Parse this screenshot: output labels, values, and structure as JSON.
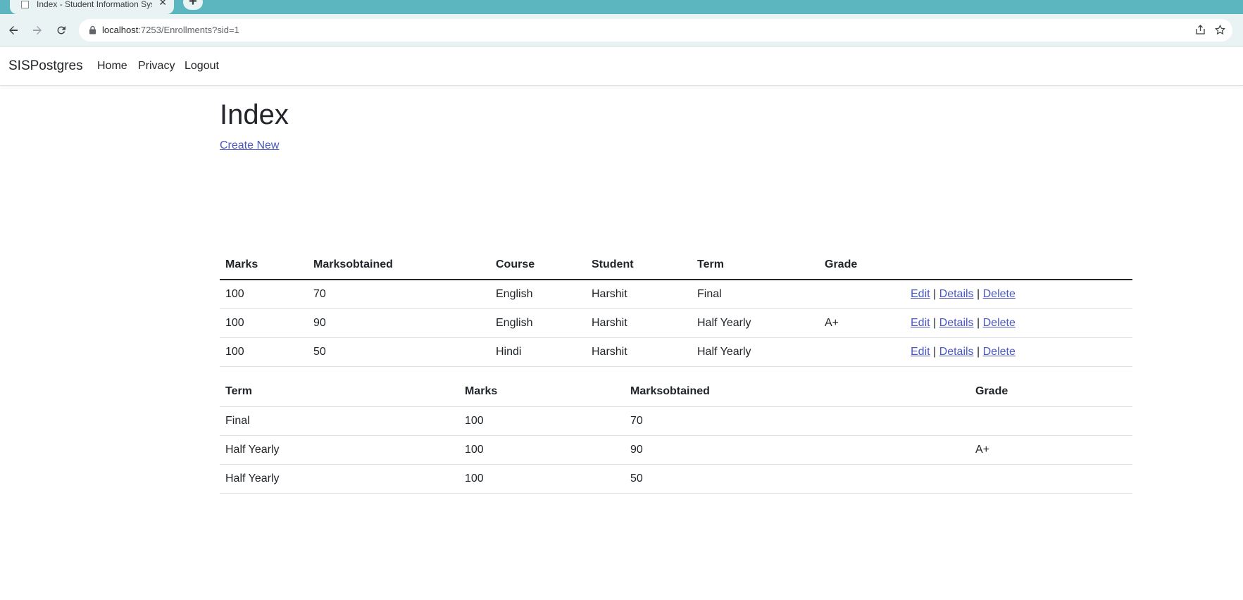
{
  "browser": {
    "tab_title": "Index - Student Information System",
    "tab_close": "✕",
    "new_tab": "+",
    "url_host": "localhost",
    "url_path": ":7253/Enrollments?sid=1"
  },
  "navbar": {
    "brand": "SISPostgres",
    "links": [
      "Home",
      "Privacy",
      "Logout"
    ]
  },
  "page": {
    "title": "Index",
    "create_link": "Create New"
  },
  "enrollments_table": {
    "headers": [
      "Marks",
      "Marksobtained",
      "Course",
      "Student",
      "Term",
      "Grade"
    ],
    "rows": [
      {
        "marks": "100",
        "marksobtained": "70",
        "course": "English",
        "student": "Harshit",
        "term": "Final",
        "grade": ""
      },
      {
        "marks": "100",
        "marksobtained": "90",
        "course": "English",
        "student": "Harshit",
        "term": "Half Yearly",
        "grade": "A+"
      },
      {
        "marks": "100",
        "marksobtained": "50",
        "course": "Hindi",
        "student": "Harshit",
        "term": "Half Yearly",
        "grade": ""
      }
    ],
    "actions": {
      "edit": "Edit",
      "details": "Details",
      "delete": "Delete",
      "separator": "|"
    }
  },
  "summary_table": {
    "headers": [
      "Term",
      "Marks",
      "Marksobtained",
      "Grade"
    ],
    "rows": [
      {
        "term": "Final",
        "marks": "100",
        "marksobtained": "70",
        "grade": ""
      },
      {
        "term": "Half Yearly",
        "marks": "100",
        "marksobtained": "90",
        "grade": "A+"
      },
      {
        "term": "Half Yearly",
        "marks": "100",
        "marksobtained": "50",
        "grade": ""
      }
    ]
  },
  "colors": {
    "chrome_accent": "#5cb6bf",
    "toolbar_bg": "#eaf3f3",
    "link": "#4a57c4",
    "text": "#212529"
  }
}
